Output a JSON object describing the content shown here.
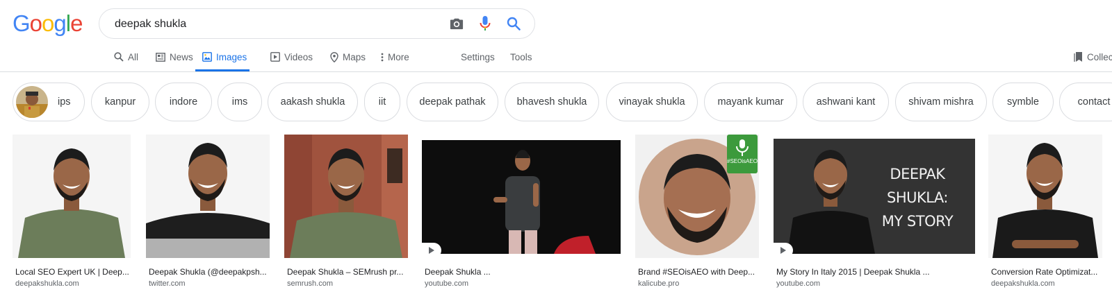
{
  "logo": {
    "letters": [
      "G",
      "o",
      "o",
      "g",
      "l",
      "e"
    ],
    "colors": [
      "#4285f4",
      "#ea4335",
      "#fbbc05",
      "#4285f4",
      "#34a853",
      "#ea4335"
    ]
  },
  "search": {
    "value": "deepak shukla"
  },
  "tabs": [
    {
      "label": "All"
    },
    {
      "label": "News"
    },
    {
      "label": "Images"
    },
    {
      "label": "Videos"
    },
    {
      "label": "Maps"
    },
    {
      "label": "More"
    }
  ],
  "tools": {
    "settings": "Settings",
    "tools": "Tools",
    "collections": "Collections"
  },
  "chips": [
    "ips",
    "kanpur",
    "indore",
    "ims",
    "aakash shukla",
    "iit",
    "deepak pathak",
    "bhavesh shukla",
    "vinayak shukla",
    "mayank kumar",
    "ashwani kant",
    "shivam mishra",
    "symble",
    "contact"
  ],
  "results": [
    {
      "title": "Local SEO Expert UK | Deep...",
      "source": "deepakshukla.com"
    },
    {
      "title": "Deepak Shukla (@deepakpsh...",
      "source": "twitter.com"
    },
    {
      "title": "Deepak Shukla – SEMrush pr...",
      "source": "semrush.com"
    },
    {
      "title": "Deepak Shukla ...",
      "source": "youtube.com"
    },
    {
      "title": "Brand #SEOisAEO with Deep...",
      "source": "kalicube.pro",
      "badge": "#SEOisAEO"
    },
    {
      "title": "My Story In Italy 2015 | Deepak Shukla ...",
      "source": "youtube.com",
      "overlay": [
        "DEEPAK SHUKLA:",
        "MY STORY"
      ]
    },
    {
      "title": "Conversion Rate Optimizat...",
      "source": "deepakshukla.com"
    }
  ],
  "colors": {
    "accent": "#1a73e8",
    "text": "#202124",
    "muted": "#5f6368",
    "border": "#dadce0"
  }
}
